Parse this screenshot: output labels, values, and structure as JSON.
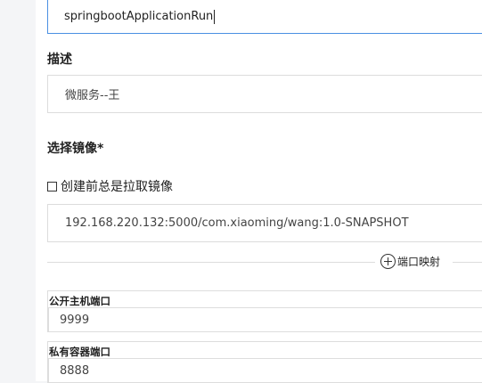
{
  "form": {
    "name_value": "springbootApplicationRun",
    "description_label": "描述",
    "description_value": "微服务--王",
    "image_label": "选择镜像*",
    "pull_checkbox_label": "创建前总是拉取镜像",
    "image_value": "192.168.220.132:5000/com.xiaoming/wang:1.0-SNAPSHOT",
    "port_mapping_label": "端口映射",
    "host_port_label": "公开主机端口",
    "host_port_value": "9999",
    "container_port_label": "私有容器端口",
    "container_port_value": "8888"
  }
}
